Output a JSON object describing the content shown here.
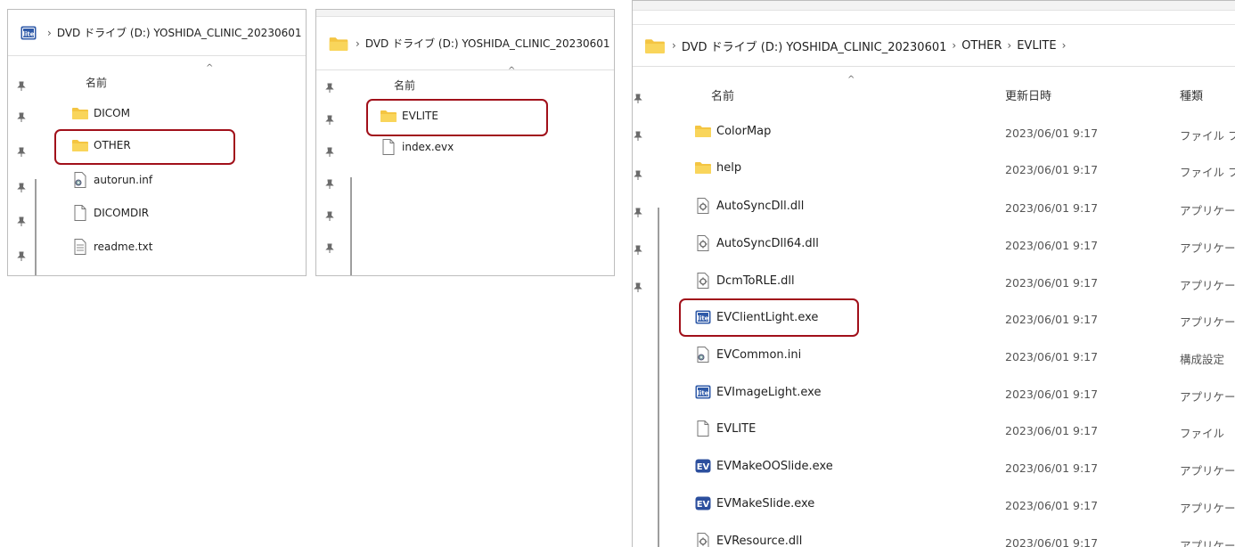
{
  "panel1": {
    "address": [
      "DVD ドライブ (D:) YOSHIDA_CLINIC_20230601"
    ],
    "header": {
      "name": "名前"
    },
    "items": [
      {
        "name": "DICOM",
        "icon": "folder-icon"
      },
      {
        "name": "OTHER",
        "icon": "folder-icon"
      },
      {
        "name": "autorun.inf",
        "icon": "settings-file-icon"
      },
      {
        "name": "DICOMDIR",
        "icon": "file-icon"
      },
      {
        "name": "readme.txt",
        "icon": "text-file-icon"
      }
    ],
    "highlighted": "OTHER"
  },
  "panel2": {
    "address": [
      "DVD ドライブ (D:) YOSHIDA_CLINIC_20230601"
    ],
    "header": {
      "name": "名前"
    },
    "items": [
      {
        "name": "EVLITE",
        "icon": "folder-icon"
      },
      {
        "name": "index.evx",
        "icon": "file-icon"
      }
    ],
    "highlighted": "EVLITE"
  },
  "panel3": {
    "address": [
      "DVD ドライブ (D:) YOSHIDA_CLINIC_20230601",
      "OTHER",
      "EVLITE"
    ],
    "header": {
      "name": "名前",
      "date": "更新日時",
      "type": "種類"
    },
    "items": [
      {
        "name": "ColorMap",
        "date": "2023/06/01 9:17",
        "type": "ファイル フォ",
        "icon": "folder-icon"
      },
      {
        "name": "help",
        "date": "2023/06/01 9:17",
        "type": "ファイル フォ",
        "icon": "folder-icon"
      },
      {
        "name": "AutoSyncDll.dll",
        "date": "2023/06/01 9:17",
        "type": "アプリケーショ",
        "icon": "dll-icon"
      },
      {
        "name": "AutoSyncDll64.dll",
        "date": "2023/06/01 9:17",
        "type": "アプリケーショ",
        "icon": "dll-icon"
      },
      {
        "name": "DcmToRLE.dll",
        "date": "2023/06/01 9:17",
        "type": "アプリケーショ",
        "icon": "dll-icon"
      },
      {
        "name": "EVClientLight.exe",
        "date": "2023/06/01 9:17",
        "type": "アプリケーショ",
        "icon": "lite-app-icon"
      },
      {
        "name": "EVCommon.ini",
        "date": "2023/06/01 9:17",
        "type": "構成設定",
        "icon": "settings-file-icon"
      },
      {
        "name": "EVImageLight.exe",
        "date": "2023/06/01 9:17",
        "type": "アプリケーショ",
        "icon": "lite-app-icon"
      },
      {
        "name": "EVLITE",
        "date": "2023/06/01 9:17",
        "type": "ファイル",
        "icon": "file-icon"
      },
      {
        "name": "EVMakeOOSlide.exe",
        "date": "2023/06/01 9:17",
        "type": "アプリケーショ",
        "icon": "ev-app-icon"
      },
      {
        "name": "EVMakeSlide.exe",
        "date": "2023/06/01 9:17",
        "type": "アプリケーショ",
        "icon": "ev-app-icon"
      },
      {
        "name": "EVResource.dll",
        "date": "2023/06/01 9:17",
        "type": "アプリケーショ",
        "icon": "dll-icon"
      }
    ],
    "highlighted": "EVClientLight.exe"
  },
  "colors": {
    "highlight": "#a1101a",
    "folder": "#f4c542",
    "lite_app": "#2f5aa8",
    "ev_app": "#2c4f9e"
  }
}
